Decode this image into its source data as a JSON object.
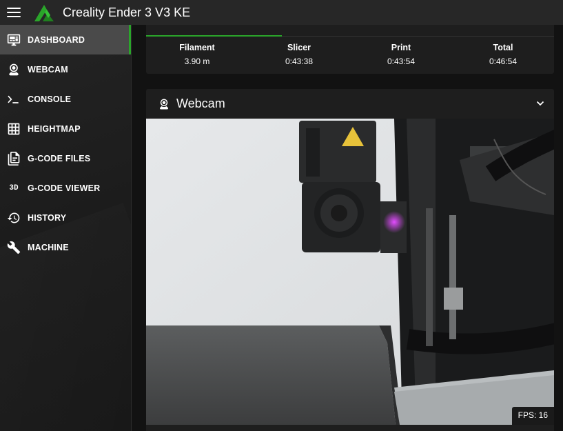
{
  "app": {
    "title": "Creality Ender 3 V3 KE"
  },
  "sidebar": {
    "items": [
      {
        "label": "DASHBOARD",
        "icon": "monitor-dashboard-icon",
        "active": true
      },
      {
        "label": "WEBCAM",
        "icon": "webcam-icon"
      },
      {
        "label": "CONSOLE",
        "icon": "console-icon"
      },
      {
        "label": "HEIGHTMAP",
        "icon": "grid-icon"
      },
      {
        "label": "G-CODE FILES",
        "icon": "file-document-icon"
      },
      {
        "label": "G-CODE VIEWER",
        "icon": "3d-icon",
        "icon_text": "3D"
      },
      {
        "label": "HISTORY",
        "icon": "history-icon"
      },
      {
        "label": "MACHINE",
        "icon": "wrench-icon"
      }
    ]
  },
  "stats": {
    "items": [
      {
        "label": "Filament",
        "value": "3.90 m"
      },
      {
        "label": "Slicer",
        "value": "0:43:38"
      },
      {
        "label": "Print",
        "value": "0:43:54"
      },
      {
        "label": "Total",
        "value": "0:46:54"
      }
    ]
  },
  "webcam": {
    "title": "Webcam",
    "fps": "FPS: 16"
  },
  "colors": {
    "accent": "#2aa52a",
    "appbar": "#272727",
    "card": "#1e1e1e",
    "background": "#121212",
    "active_item": "#4a4a4a"
  }
}
